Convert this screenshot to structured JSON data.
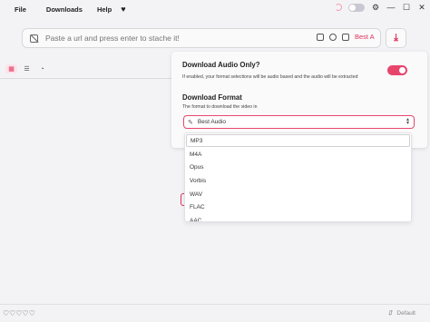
{
  "menu": {
    "items": [
      "File",
      "Downloads",
      "Help"
    ],
    "heart": "♥"
  },
  "window": {
    "settings_glyph": "⚙",
    "minimize_glyph": "—",
    "maximize_glyph": "☐",
    "close_glyph": "✕"
  },
  "urlbar": {
    "placeholder": "Paste a url and press enter to stache it!",
    "format_label": "Best Au",
    "download_glyph": "⤓"
  },
  "tabs": {
    "items": [
      {
        "name": "grid-view-icon",
        "glyph": "▦"
      },
      {
        "name": "list-view-icon",
        "glyph": "☰"
      },
      {
        "name": "rss-icon",
        "glyph": "◔"
      }
    ]
  },
  "settings": {
    "audio_only_title": "Download Audio Only?",
    "audio_only_desc": "If enabled, your format selections will be audio based and the audio will be extracted",
    "audio_only_enabled": true,
    "format_title": "Download Format",
    "format_desc": "The format to download the video in",
    "format_selected": "Best Audio",
    "format_options": [
      "MP3",
      "M4A",
      "Opus",
      "Vorbis",
      "WAV",
      "FLAC",
      "AAC"
    ]
  },
  "status": {
    "hearts": "♡♡♡♡♡",
    "profile_label": "Default",
    "profile_glyph": "⇵"
  },
  "colors": {
    "accent": "#e8456c",
    "background": "#f3f3f5"
  }
}
